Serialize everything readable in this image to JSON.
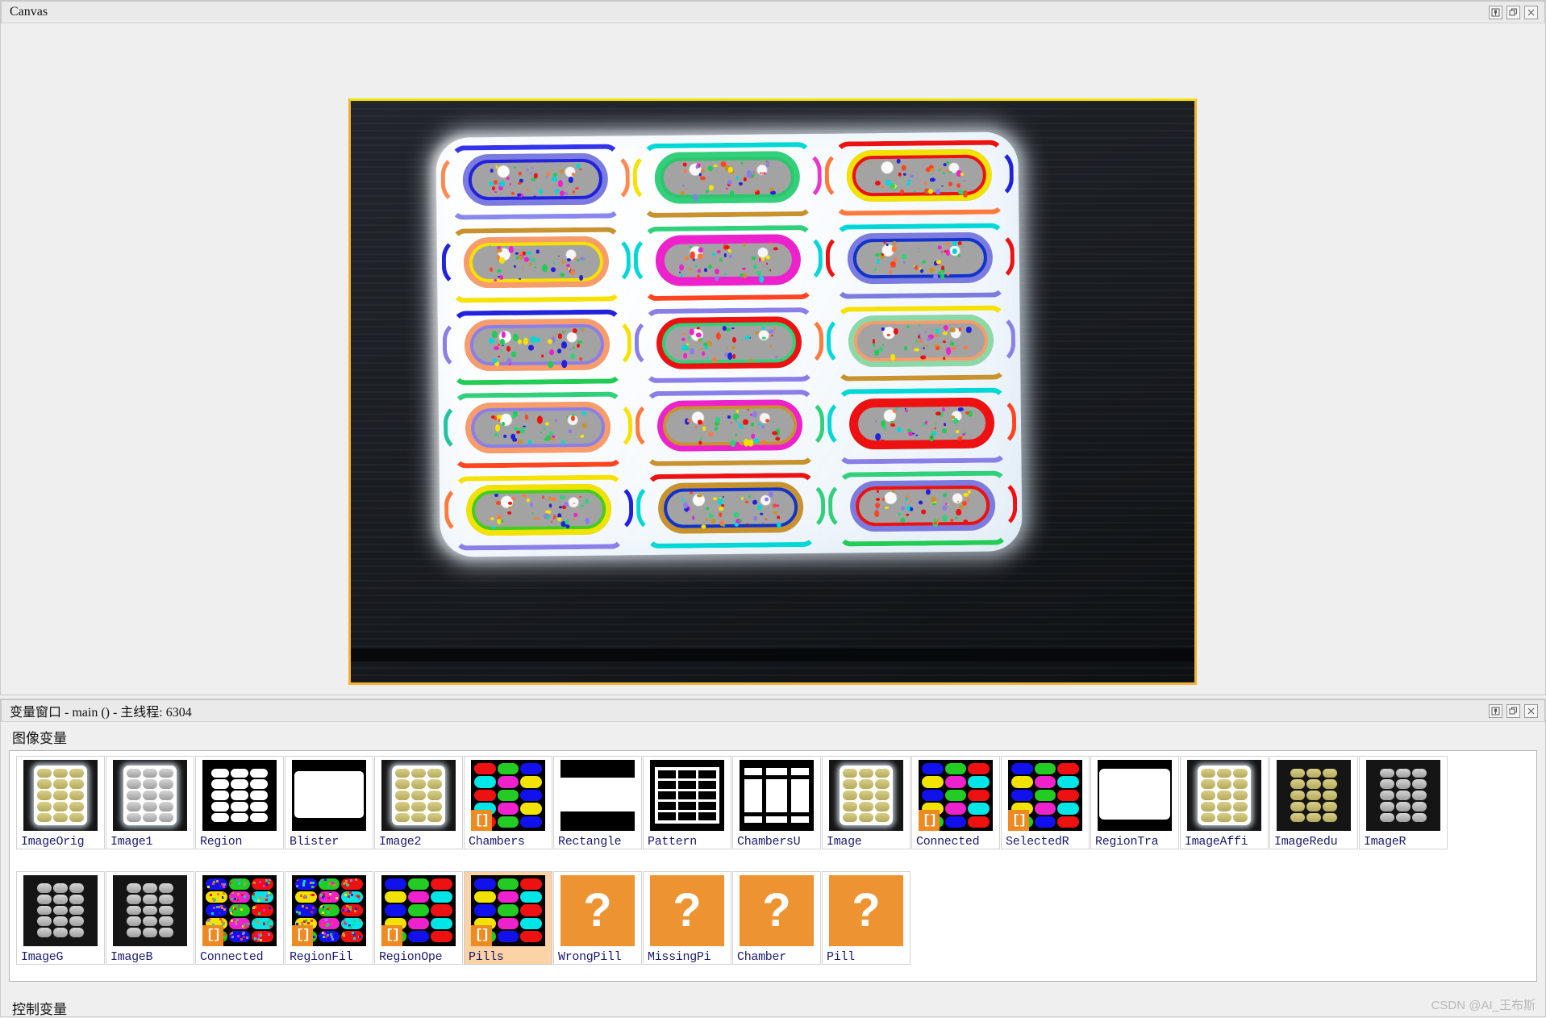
{
  "canvas_window": {
    "title": "Canvas",
    "buttons": [
      {
        "name": "pin-button",
        "icon": "pin-icon"
      },
      {
        "name": "restore-button",
        "icon": "restore-icon"
      },
      {
        "name": "close-button",
        "icon": "close-icon"
      }
    ],
    "image": {
      "description": "Blister pack of 15 capsules with color-segmented regions",
      "border_color": "#f2b134",
      "top_border_color": "#f5e400",
      "pills": [
        {
          "row": 1,
          "col": 1,
          "inner": "#7b7be0",
          "ring": "#2222dd",
          "arc_top": "#3333ee",
          "arc_bottom": "#8888ee",
          "arc_left": "#ff8a50",
          "arc_right": "#ff8a50"
        },
        {
          "row": 1,
          "col": 2,
          "inner": "#32d07a",
          "ring": "#2fc46e",
          "arc_top": "#00d8d8",
          "arc_bottom": "#c8932f",
          "arc_left": "#f6e200",
          "arc_right": "#e838c8"
        },
        {
          "row": 1,
          "col": 3,
          "inner": "#f2e200",
          "ring": "#ee1111",
          "arc_top": "#ee1111",
          "arc_bottom": "#ff7a3c",
          "arc_left": "#ff7a3c",
          "arc_right": "#2222dd"
        },
        {
          "row": 2,
          "col": 1,
          "inner": "#f79c6a",
          "ring": "#f6e200",
          "arc_top": "#c8932f",
          "arc_bottom": "#f6e200",
          "arc_left": "#2222dd",
          "arc_right": "#00d8d8"
        },
        {
          "row": 2,
          "col": 2,
          "inner": "#ee22cc",
          "ring": "#ee22cc",
          "arc_top": "#32d07a",
          "arc_bottom": "#ff4422",
          "arc_left": "#00d8d8",
          "arc_right": "#00d8d8"
        },
        {
          "row": 2,
          "col": 3,
          "inner": "#7b7be0",
          "ring": "#1133cc",
          "arc_top": "#00d8d8",
          "arc_bottom": "#7b7be0",
          "arc_left": "#ee1111",
          "arc_right": "#ee1111"
        },
        {
          "row": 3,
          "col": 1,
          "inner": "#f79c6a",
          "ring": "#8a7fe8",
          "arc_top": "#2222dd",
          "arc_bottom": "#22cc55",
          "arc_left": "#8a7fe8",
          "arc_right": "#f6e200"
        },
        {
          "row": 3,
          "col": 2,
          "inner": "#ee1111",
          "ring": "#32d07a",
          "arc_top": "#8a7fe8",
          "arc_bottom": "#8a7fe8",
          "arc_left": "#8a7fe8",
          "arc_right": "#ff7a3c"
        },
        {
          "row": 3,
          "col": 3,
          "inner": "#8cd9a8",
          "ring": "#f79c6a",
          "arc_top": "#f6e200",
          "arc_bottom": "#c8932f",
          "arc_left": "#00d8d8",
          "arc_right": "#8a7fe8"
        },
        {
          "row": 4,
          "col": 1,
          "inner": "#f79c6a",
          "ring": "#8a7fe8",
          "arc_top": "#32d07a",
          "arc_bottom": "#ff4422",
          "arc_left": "#22c4a0",
          "arc_right": "#f6e200"
        },
        {
          "row": 4,
          "col": 2,
          "inner": "#ee22cc",
          "ring": "#c8932f",
          "arc_top": "#8a7fe8",
          "arc_bottom": "#c8932f",
          "arc_left": "#ff7a3c",
          "arc_right": "#32d07a"
        },
        {
          "row": 4,
          "col": 3,
          "inner": "#ee1111",
          "ring": "#ee1111",
          "arc_top": "#00d8d8",
          "arc_bottom": "#8a7fe8",
          "arc_left": "#00d8d8",
          "arc_right": "#ff4422"
        },
        {
          "row": 5,
          "col": 1,
          "inner": "#f2e200",
          "ring": "#44cc22",
          "arc_top": "#f6e200",
          "arc_bottom": "#8a7fe8",
          "arc_left": "#ff7a3c",
          "arc_right": "#2222dd"
        },
        {
          "row": 5,
          "col": 2,
          "inner": "#c8932f",
          "ring": "#1133cc",
          "arc_top": "#ee1111",
          "arc_bottom": "#00d8d8",
          "arc_left": "#00d8d8",
          "arc_right": "#32d07a"
        },
        {
          "row": 5,
          "col": 3,
          "inner": "#7b7be0",
          "ring": "#ee1111",
          "arc_top": "#32d07a",
          "arc_bottom": "#22cc55",
          "arc_left": "#32d07a",
          "arc_right": "#ee1111"
        }
      ]
    }
  },
  "variable_window": {
    "title": "变量窗口 - main () - 主线程: 6304",
    "buttons": [
      {
        "name": "pin-button",
        "icon": "pin-icon"
      },
      {
        "name": "restore-button",
        "icon": "restore-icon"
      },
      {
        "name": "close-button",
        "icon": "close-icon"
      }
    ],
    "image_vars_label": "图像变量",
    "control_vars_label": "控制变量",
    "selected_variable": "Pills",
    "array_badge": "[]",
    "question_mark": "?",
    "rows": [
      [
        {
          "label": "ImageOrig",
          "kind": "photo-color",
          "array": false
        },
        {
          "label": "Image1",
          "kind": "photo-gray",
          "array": false
        },
        {
          "label": "Region",
          "kind": "region-white",
          "array": false
        },
        {
          "label": "Blister",
          "kind": "blister-rect",
          "array": false
        },
        {
          "label": "Image2",
          "kind": "photo-color",
          "array": false
        },
        {
          "label": "Chambers",
          "kind": "color-grid",
          "array": true
        },
        {
          "label": "Rectangle",
          "kind": "rect-band",
          "array": false
        },
        {
          "label": "Pattern",
          "kind": "pattern-grid",
          "array": false
        },
        {
          "label": "ChambersU",
          "kind": "chambers-union",
          "array": false
        },
        {
          "label": "Image",
          "kind": "photo-color",
          "array": false
        },
        {
          "label": "Connected",
          "kind": "caps-color",
          "array": true
        },
        {
          "label": "SelectedR",
          "kind": "caps-color",
          "array": true
        },
        {
          "label": "RegionTra",
          "kind": "region-trans",
          "array": false
        },
        {
          "label": "ImageAffi",
          "kind": "photo-color",
          "array": false
        },
        {
          "label": "ImageRedu",
          "kind": "photo-reduced",
          "array": false
        },
        {
          "label": "ImageR",
          "kind": "photo-gray-reduced",
          "array": false
        }
      ],
      [
        {
          "label": "ImageG",
          "kind": "photo-gray-reduced",
          "array": false
        },
        {
          "label": "ImageB",
          "kind": "photo-gray-reduced",
          "array": false
        },
        {
          "label": "Connected",
          "kind": "caps-speckle",
          "array": true
        },
        {
          "label": "RegionFil",
          "kind": "caps-speckle",
          "array": true
        },
        {
          "label": "RegionOpe",
          "kind": "caps-color",
          "array": true
        },
        {
          "label": "Pills",
          "kind": "caps-color",
          "array": true,
          "selected": true
        },
        {
          "label": "WrongPill",
          "kind": "unknown",
          "array": false
        },
        {
          "label": "MissingPi",
          "kind": "unknown",
          "array": false
        },
        {
          "label": "Chamber",
          "kind": "unknown",
          "array": false
        },
        {
          "label": "Pill",
          "kind": "unknown",
          "array": false
        }
      ]
    ]
  },
  "watermark": "CSDN @AI_王布斯",
  "colors": {
    "accent_orange": "#ee9331",
    "selection_bg": "#fbd3a6",
    "label_blue": "#1a1a6e",
    "window_chrome": "#eaeaea"
  }
}
